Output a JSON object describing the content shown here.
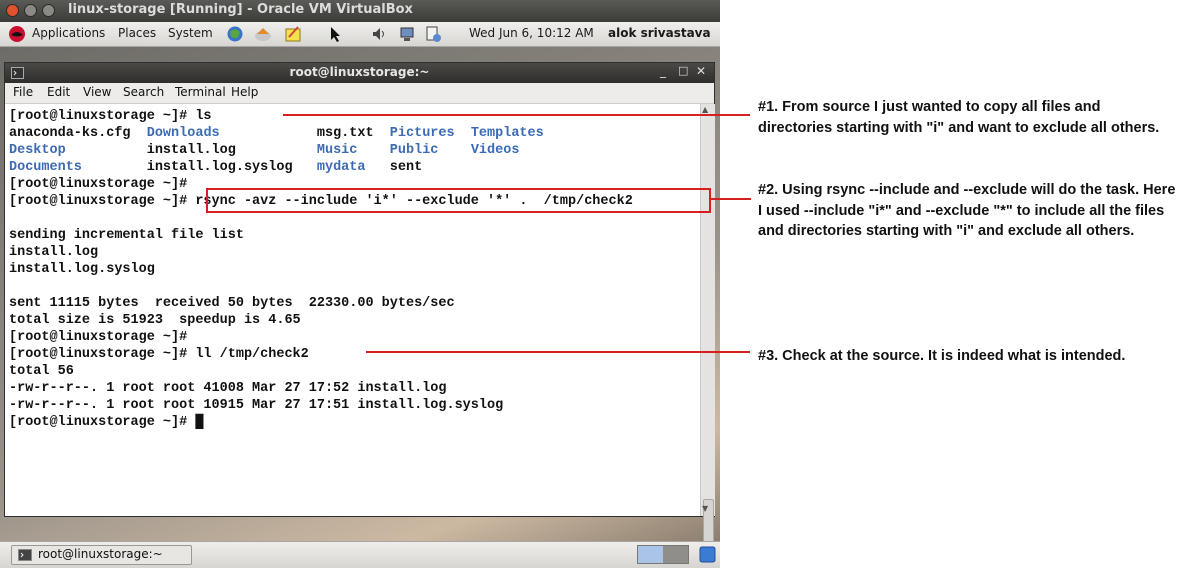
{
  "vbox": {
    "title": "linux-storage [Running] - Oracle VM VirtualBox"
  },
  "panel": {
    "applications": "Applications",
    "places": "Places",
    "system": "System",
    "datetime": "Wed Jun  6, 10:12 AM",
    "user": "alok srivastava"
  },
  "terminal": {
    "title": "root@linuxstorage:~",
    "menu": [
      "File",
      "Edit",
      "View",
      "Search",
      "Terminal",
      "Help"
    ],
    "lines": [
      [
        {
          "t": "[root@linuxstorage ~]# ls"
        }
      ],
      [
        {
          "t": "anaconda-ks.cfg  "
        },
        {
          "t": "Downloads",
          "c": "blue"
        },
        {
          "t": "            msg.txt  "
        },
        {
          "t": "Pictures",
          "c": "blue"
        },
        {
          "t": "  "
        },
        {
          "t": "Templates",
          "c": "blue"
        }
      ],
      [
        {
          "t": "Desktop",
          "c": "blue"
        },
        {
          "t": "          install.log          "
        },
        {
          "t": "Music",
          "c": "blue"
        },
        {
          "t": "    "
        },
        {
          "t": "Public",
          "c": "blue"
        },
        {
          "t": "    "
        },
        {
          "t": "Videos",
          "c": "blue"
        }
      ],
      [
        {
          "t": "Documents",
          "c": "blue"
        },
        {
          "t": "        install.log.syslog   "
        },
        {
          "t": "mydata",
          "c": "blue"
        },
        {
          "t": "   sent"
        }
      ],
      [
        {
          "t": "[root@linuxstorage ~]#"
        }
      ],
      [
        {
          "t": "[root@linuxstorage ~]# rsync -avz --include 'i*' --exclude '*' .  /tmp/check2"
        }
      ],
      [
        {
          "t": ""
        }
      ],
      [
        {
          "t": "sending incremental file list"
        }
      ],
      [
        {
          "t": "install.log"
        }
      ],
      [
        {
          "t": "install.log.syslog"
        }
      ],
      [
        {
          "t": ""
        }
      ],
      [
        {
          "t": "sent 11115 bytes  received 50 bytes  22330.00 bytes/sec"
        }
      ],
      [
        {
          "t": "total size is 51923  speedup is 4.65"
        }
      ],
      [
        {
          "t": "[root@linuxstorage ~]#"
        }
      ],
      [
        {
          "t": "[root@linuxstorage ~]# ll /tmp/check2"
        }
      ],
      [
        {
          "t": "total 56"
        }
      ],
      [
        {
          "t": "-rw-r--r--. 1 root root 41008 Mar 27 17:52 install.log"
        }
      ],
      [
        {
          "t": "-rw-r--r--. 1 root root 10915 Mar 27 17:51 install.log.syslog"
        }
      ],
      [
        {
          "t": "[root@linuxstorage ~]# "
        },
        {
          "t": "█"
        }
      ]
    ]
  },
  "taskbar": {
    "task_label": "root@linuxstorage:~"
  },
  "annotations": {
    "note1": "#1. From source I just wanted to copy all files and directories starting with \"i\" and want to exclude all others.",
    "note2": "#2. Using rsync --include and --exclude will do the task. Here I used --include \"i*\" and --exclude \"*\"  to include all the files and directories starting with \"i\" and exclude all others.",
    "note3": "#3. Check at the source. It is indeed what is intended."
  },
  "colors": {
    "annotation_red": "#d62020",
    "directory_blue": "#3d6bb3"
  }
}
